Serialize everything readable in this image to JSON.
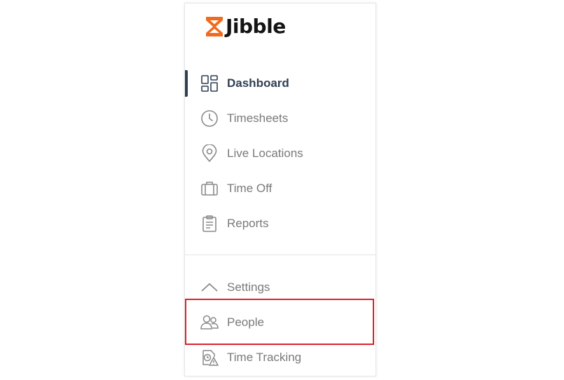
{
  "brand": {
    "name": "Jibble",
    "logo_color": "#f26b1d"
  },
  "nav": {
    "dashboard": {
      "label": "Dashboard",
      "icon": "dashboard-grid-icon",
      "active": true
    },
    "timesheets": {
      "label": "Timesheets",
      "icon": "clock-icon"
    },
    "live_locations": {
      "label": "Live Locations",
      "icon": "map-pin-icon"
    },
    "time_off": {
      "label": "Time Off",
      "icon": "suitcase-icon"
    },
    "reports": {
      "label": "Reports",
      "icon": "clipboard-icon"
    }
  },
  "settings": {
    "label": "Settings",
    "icon": "chevron-up-icon",
    "items": {
      "people": {
        "label": "People",
        "icon": "people-icon",
        "highlighted": true
      },
      "time_tracking": {
        "label": "Time Tracking",
        "icon": "time-tracking-warning-icon"
      }
    }
  },
  "colors": {
    "active_text": "#2f3f52",
    "inactive_text": "#7a7a7a",
    "highlight_border": "#d9232a"
  }
}
